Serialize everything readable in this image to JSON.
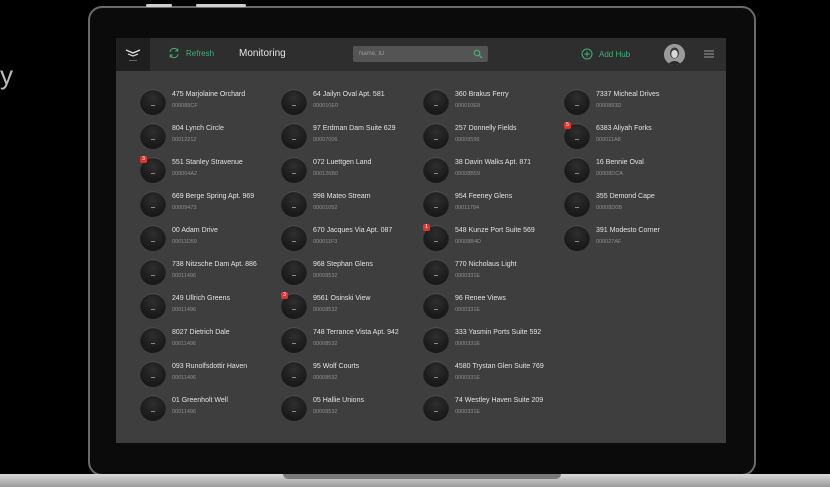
{
  "side_glyph": "y",
  "topbar": {
    "refresh_label": "Refresh",
    "title": "Monitoring",
    "search_placeholder": "Name, ID",
    "add_hub_label": "Add Hub"
  },
  "colors": {
    "accent": "#3fb277",
    "badge": "#e0342f",
    "background": "#3e3e3e"
  },
  "columns": [
    [
      {
        "name": "475 Marjolaine Orchard",
        "id": "000089CF",
        "badge": ""
      },
      {
        "name": "804 Lynch Circle",
        "id": "00012212",
        "badge": ""
      },
      {
        "name": "551 Stanley Stravenue",
        "id": "000064A2",
        "badge": "3"
      },
      {
        "name": "669 Berge Spring Apt. 969",
        "id": "00009473",
        "badge": ""
      },
      {
        "name": "00 Adam Drive",
        "id": "00011D59",
        "badge": ""
      },
      {
        "name": "738 Nitzsche Dam Apt. 886",
        "id": "00011496",
        "badge": ""
      },
      {
        "name": "249 Ullrich Greens",
        "id": "00011496",
        "badge": ""
      },
      {
        "name": "8027 Dietrich Dale",
        "id": "00011496",
        "badge": ""
      },
      {
        "name": "093 Runolfsdottir Haven",
        "id": "00011496",
        "badge": ""
      },
      {
        "name": "01 Greenholt Well",
        "id": "00011496",
        "badge": ""
      }
    ],
    [
      {
        "name": "64 Jailyn Oval Apt. 581",
        "id": "000010E0",
        "badge": ""
      },
      {
        "name": "97 Erdman Dam Suite 629",
        "id": "00007006",
        "badge": ""
      },
      {
        "name": "072 Luettgen Land",
        "id": "000126B0",
        "badge": ""
      },
      {
        "name": "998 Mateo Stream",
        "id": "00001052",
        "badge": ""
      },
      {
        "name": "670 Jacques Via Apt. 087",
        "id": "000011F3",
        "badge": ""
      },
      {
        "name": "968 Stephan Glens",
        "id": "00008532",
        "badge": ""
      },
      {
        "name": "9561 Osinski View",
        "id": "00008532",
        "badge": "3"
      },
      {
        "name": "748 Terrance Vista Apt. 942",
        "id": "00008532",
        "badge": ""
      },
      {
        "name": "95 Wolf Courts",
        "id": "00008532",
        "badge": ""
      },
      {
        "name": "05 Hallie Unions",
        "id": "00008532",
        "badge": ""
      }
    ],
    [
      {
        "name": "360 Brakus Ferry",
        "id": "000010E8",
        "badge": ""
      },
      {
        "name": "257 Donnelly Fields",
        "id": "00009599",
        "badge": ""
      },
      {
        "name": "38 Davin Walks Apt. 871",
        "id": "00008B59",
        "badge": ""
      },
      {
        "name": "954 Feeney Glens",
        "id": "00011784",
        "badge": ""
      },
      {
        "name": "548 Kunze Port Suite 569",
        "id": "00008B4D",
        "badge": "1"
      },
      {
        "name": "770 Nicholaus Light",
        "id": "0000331E",
        "badge": ""
      },
      {
        "name": "96 Renee Views",
        "id": "0000331E",
        "badge": ""
      },
      {
        "name": "333 Yasmin Ports Suite 592",
        "id": "0000331E",
        "badge": ""
      },
      {
        "name": "4580 Trystan Glen Suite 769",
        "id": "0000331E",
        "badge": ""
      },
      {
        "name": "74 Westley Haven Suite 209",
        "id": "0000331E",
        "badge": ""
      }
    ],
    [
      {
        "name": "7337 Micheal Drives",
        "id": "0000893D",
        "badge": ""
      },
      {
        "name": "6383 Aliyah Forks",
        "id": "000011A8",
        "badge": "5"
      },
      {
        "name": "16 Bennie Oval",
        "id": "00008DCA",
        "badge": ""
      },
      {
        "name": "355 Demond Cape",
        "id": "00008D0B",
        "badge": ""
      },
      {
        "name": "391 Modesto Corner",
        "id": "000027AF",
        "badge": ""
      }
    ]
  ]
}
